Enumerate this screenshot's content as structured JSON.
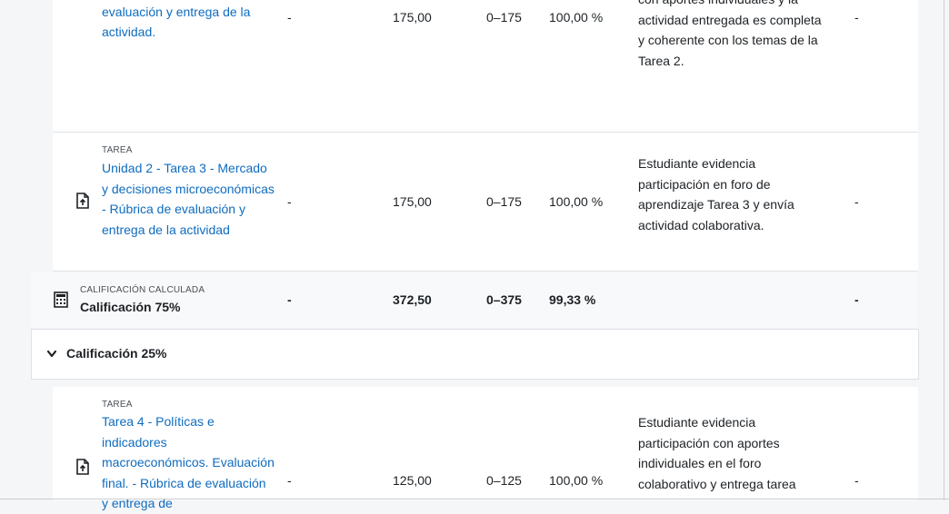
{
  "rows": [
    {
      "kind": "",
      "title": "producción - Rúbrica de evaluación y entrega de la actividad.",
      "weight": "-",
      "grade": "175,00",
      "range": "0–175",
      "percent": "100,00 %",
      "feedback": "con aportes individuales y la actividad entregada es completa y coherente con los temas de la Tarea 2.",
      "contribution": "-"
    },
    {
      "kind": "TAREA",
      "title": "Unidad 2 - Tarea 3 - Mercado y decisiones microeconómicas - Rúbrica de evaluación y entrega de la actividad",
      "weight": "-",
      "grade": "175,00",
      "range": "0–175",
      "percent": "100,00 %",
      "feedback": "Estudiante evidencia participación en foro de aprendizaje Tarea 3 y envía actividad colaborativa.",
      "contribution": "-"
    },
    {
      "kind": "CALIFICACIÓN CALCULADA",
      "title": "Calificación 75%",
      "weight": "-",
      "grade": "372,50",
      "range": "0–375",
      "percent": "99,33 %",
      "feedback": "",
      "contribution": "-"
    },
    {
      "kind": "TAREA",
      "title": "Tarea 4 - Políticas e indicadores macroeconómicos. Evaluación final. - Rúbrica de evaluación y entrega de",
      "weight": "-",
      "grade": "125,00",
      "range": "0–125",
      "percent": "100,00 %",
      "feedback": "Estudiante evidencia participación con aportes individuales en el foro colaborativo y entrega tarea",
      "contribution": "-"
    }
  ],
  "category": {
    "title": "Calificación 25%",
    "expanded": true
  },
  "icons": {
    "assignment": "assignment-upload-icon",
    "calculator": "calculator-icon",
    "chevron": "chevron-down-icon"
  },
  "colors": {
    "link": "#0f6cbf",
    "border": "#dee2e6",
    "background": "#f5f6f8",
    "calc_row": "#f8f9fa"
  }
}
